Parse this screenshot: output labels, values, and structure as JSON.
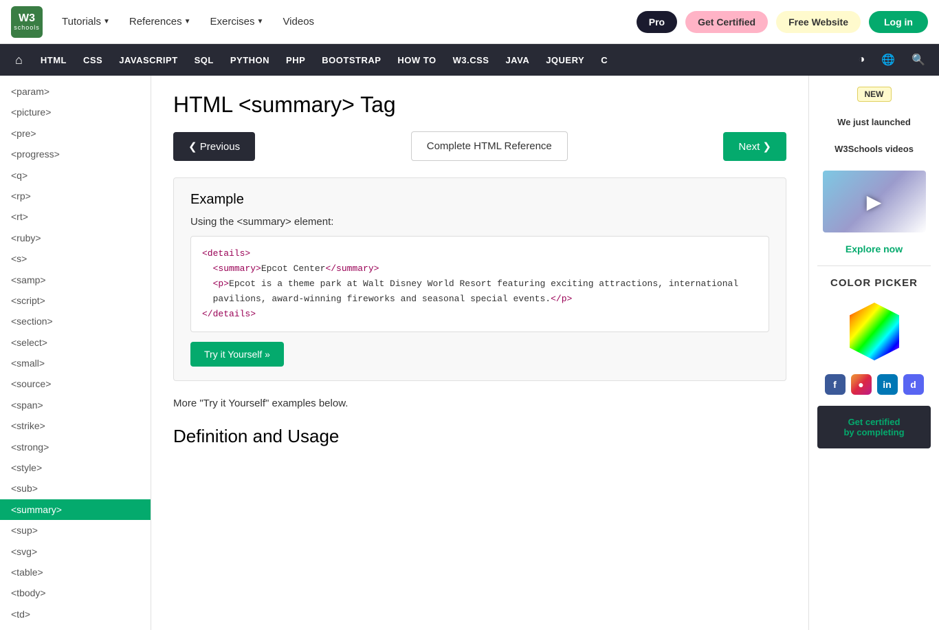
{
  "topNav": {
    "logo_w3": "W3",
    "logo_schools": "schools",
    "nav_items": [
      {
        "label": "Tutorials",
        "has_arrow": true
      },
      {
        "label": "References",
        "has_arrow": true
      },
      {
        "label": "Exercises",
        "has_arrow": true
      },
      {
        "label": "Videos",
        "has_arrow": false
      }
    ],
    "btn_pro": "Pro",
    "btn_certified": "Get Certified",
    "btn_website": "Free Website",
    "btn_login": "Log in"
  },
  "secNav": {
    "items": [
      "HTML",
      "CSS",
      "JAVASCRIPT",
      "SQL",
      "PYTHON",
      "PHP",
      "BOOTSTRAP",
      "HOW TO",
      "W3.CSS",
      "JAVA",
      "JQUERY",
      "C"
    ]
  },
  "sidebar": {
    "items": [
      {
        "label": "<param>",
        "active": false
      },
      {
        "label": "<picture>",
        "active": false
      },
      {
        "label": "<pre>",
        "active": false
      },
      {
        "label": "<progress>",
        "active": false
      },
      {
        "label": "<q>",
        "active": false
      },
      {
        "label": "<rp>",
        "active": false
      },
      {
        "label": "<rt>",
        "active": false
      },
      {
        "label": "<ruby>",
        "active": false
      },
      {
        "label": "<s>",
        "active": false
      },
      {
        "label": "<samp>",
        "active": false
      },
      {
        "label": "<script>",
        "active": false
      },
      {
        "label": "<section>",
        "active": false
      },
      {
        "label": "<select>",
        "active": false
      },
      {
        "label": "<small>",
        "active": false
      },
      {
        "label": "<source>",
        "active": false
      },
      {
        "label": "<span>",
        "active": false
      },
      {
        "label": "<strike>",
        "active": false
      },
      {
        "label": "<strong>",
        "active": false
      },
      {
        "label": "<style>",
        "active": false
      },
      {
        "label": "<sub>",
        "active": false
      },
      {
        "label": "<summary>",
        "active": true
      },
      {
        "label": "<sup>",
        "active": false
      },
      {
        "label": "<svg>",
        "active": false
      },
      {
        "label": "<table>",
        "active": false
      },
      {
        "label": "<tbody>",
        "active": false
      },
      {
        "label": "<td>",
        "active": false
      }
    ]
  },
  "main": {
    "page_title": "HTML <summary> Tag",
    "btn_prev": "❮ Previous",
    "btn_complete_ref": "Complete HTML Reference",
    "btn_next": "Next ❯",
    "example": {
      "title": "Example",
      "desc": "Using the <summary> element:",
      "code_line1": "<details>",
      "code_line2": "  <summary>Epcot Center</summary>",
      "code_line3": "  <p>Epcot is a theme park at Walt Disney World Resort featuring exciting attractions, international",
      "code_line4": "pavilions, award-winning fireworks and seasonal special events.</p>",
      "code_line5": "</details>",
      "btn_try": "Try it Yourself »"
    },
    "more_examples": "More \"Try it Yourself\" examples below.",
    "def_usage_title": "Definition and Usage"
  },
  "rightSidebar": {
    "new_badge": "NEW",
    "promo_text1": "We just launched",
    "promo_text2": "W3Schools videos",
    "explore_link": "Explore now",
    "color_picker_title": "COLOR PICKER",
    "cert_text1": "Get certified",
    "cert_text2": "by completing"
  }
}
